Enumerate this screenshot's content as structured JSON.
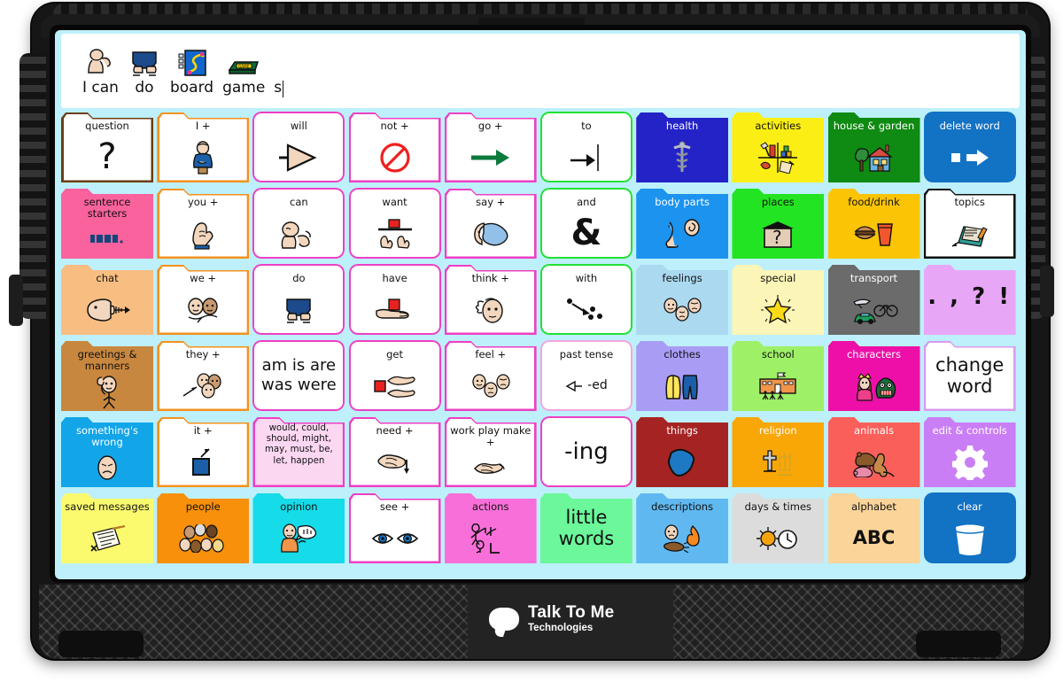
{
  "device": {
    "brand_line1": "Talk To Me",
    "brand_line2": "Technologies"
  },
  "message_bar": {
    "items": [
      {
        "label": "I can",
        "icon": "person-flexing-icon"
      },
      {
        "label": "do",
        "icon": "legs-walking-icon"
      },
      {
        "label": "board",
        "icon": "board-game-icon"
      },
      {
        "label": "game",
        "icon": "game-box-icon"
      },
      {
        "label": "s",
        "icon": "none"
      }
    ],
    "caret": true
  },
  "board": {
    "columns": 10,
    "rows": 6,
    "background": "#bdf0fb",
    "buttons": [
      {
        "label": "question",
        "icon": "question-mark-icon",
        "shape": "folder",
        "fill": "#ffffff",
        "border": "#6b3e14",
        "text": "#111111",
        "icon_text": "?",
        "icon_style": "glyph-qmark"
      },
      {
        "label": "I +",
        "icon": "person-pointing-self-icon",
        "shape": "folder",
        "fill": "#ffffff",
        "border": "#f4911e",
        "text": "#111111"
      },
      {
        "label": "will",
        "icon": "arrow-triangle-icon",
        "shape": "rounded",
        "fill": "#ffffff",
        "border": "#ef3fc4",
        "text": "#111111"
      },
      {
        "label": "not +",
        "icon": "no-entry-icon",
        "shape": "folder",
        "fill": "#ffffff",
        "border": "#ef3fc4",
        "text": "#111111"
      },
      {
        "label": "go +",
        "icon": "green-arrow-right-icon",
        "shape": "folder",
        "fill": "#ffffff",
        "border": "#ef3fc4",
        "text": "#111111"
      },
      {
        "label": "to",
        "icon": "arrow-to-line-icon",
        "shape": "rounded",
        "fill": "#ffffff",
        "border": "#22e032",
        "text": "#111111"
      },
      {
        "label": "health",
        "icon": "caduceus-icon",
        "shape": "folder",
        "fill": "#2323c8",
        "border": "#2323c8",
        "text": "#ffffff"
      },
      {
        "label": "activities",
        "icon": "craft-shelf-icon",
        "shape": "folder",
        "fill": "#fbee14",
        "border": "#fbee14",
        "text": "#111111"
      },
      {
        "label": "house & garden",
        "icon": "house-tree-icon",
        "shape": "folder",
        "fill": "#0f8a12",
        "border": "#0f8a12",
        "text": "#ffffff"
      },
      {
        "label": "delete word",
        "icon": "backspace-icon",
        "shape": "rounded",
        "fill": "#1272c4",
        "border": "#1272c4",
        "text": "#ffffff"
      },
      {
        "label": "sentence\nstarters",
        "icon": "sentence-blocks-icon",
        "shape": "folder",
        "fill": "#f9629c",
        "border": "#f9629c",
        "text": "#111111"
      },
      {
        "label": "you +",
        "icon": "pointing-hand-icon",
        "shape": "folder",
        "fill": "#ffffff",
        "border": "#f4911e",
        "text": "#111111"
      },
      {
        "label": "can",
        "icon": "flexing-arm-icon",
        "shape": "rounded",
        "fill": "#ffffff",
        "border": "#ef3fc4",
        "text": "#111111"
      },
      {
        "label": "want",
        "icon": "hands-reaching-block-icon",
        "shape": "rounded",
        "fill": "#ffffff",
        "border": "#ef3fc4",
        "text": "#111111"
      },
      {
        "label": "say +",
        "icon": "speech-head-icon",
        "shape": "folder",
        "fill": "#ffffff",
        "border": "#ef3fc4",
        "text": "#111111"
      },
      {
        "label": "and",
        "icon": "ampersand-icon",
        "shape": "rounded",
        "fill": "#ffffff",
        "border": "#22e032",
        "text": "#111111",
        "icon_text": "&",
        "icon_style": "glyph-amp"
      },
      {
        "label": "body parts",
        "icon": "ear-leg-icon",
        "shape": "folder",
        "fill": "#1c93ef",
        "border": "#1c93ef",
        "text": "#ffffff"
      },
      {
        "label": "places",
        "icon": "building-question-icon",
        "shape": "folder",
        "fill": "#23e423",
        "border": "#23e423",
        "text": "#111111"
      },
      {
        "label": "food/drink",
        "icon": "burger-drink-icon",
        "shape": "folder",
        "fill": "#fbc405",
        "border": "#fbc405",
        "text": "#111111"
      },
      {
        "label": "topics",
        "icon": "topics-cards-icon",
        "shape": "folder",
        "fill": "#ffffff",
        "border": "#111111",
        "text": "#111111"
      },
      {
        "label": "chat",
        "icon": "talking-head-icon",
        "shape": "folder",
        "fill": "#f7bd81",
        "border": "#f7bd81",
        "text": "#111111"
      },
      {
        "label": "we +",
        "icon": "two-faces-icon",
        "shape": "folder",
        "fill": "#ffffff",
        "border": "#f4911e",
        "text": "#111111"
      },
      {
        "label": "do",
        "icon": "legs-walking-icon",
        "shape": "rounded",
        "fill": "#ffffff",
        "border": "#ef3fc4",
        "text": "#111111"
      },
      {
        "label": "have",
        "icon": "hand-holding-block-icon",
        "shape": "rounded",
        "fill": "#ffffff",
        "border": "#ef3fc4",
        "text": "#111111"
      },
      {
        "label": "think +",
        "icon": "thinking-head-icon",
        "shape": "folder",
        "fill": "#ffffff",
        "border": "#ef3fc4",
        "text": "#111111"
      },
      {
        "label": "with",
        "icon": "arrow-dots-icon",
        "shape": "rounded",
        "fill": "#ffffff",
        "border": "#22e032",
        "text": "#111111"
      },
      {
        "label": "feelings",
        "icon": "three-faces-icon",
        "shape": "folder",
        "fill": "#aad9f0",
        "border": "#aad9f0",
        "text": "#111111"
      },
      {
        "label": "special",
        "icon": "star-burst-icon",
        "shape": "folder",
        "fill": "#fcf5b8",
        "border": "#fcf5b8",
        "text": "#111111"
      },
      {
        "label": "transport",
        "icon": "car-bike-plane-icon",
        "shape": "folder",
        "fill": "#6b6b6b",
        "border": "#6b6b6b",
        "text": "#ffffff"
      },
      {
        "label": "",
        "icon": "punctuation-icon",
        "shape": "folder",
        "fill": "#e8a6f7",
        "border": "#e8a6f7",
        "text": "#111111",
        "icon_text": ".  ,  ?  !",
        "icon_style": "glyph-punct"
      },
      {
        "label": "greetings &\nmanners",
        "icon": "waving-person-icon",
        "shape": "folder",
        "fill": "#cd8game",
        "border": "#c8873f",
        "text": "#111111"
      },
      {
        "label": "they +",
        "icon": "group-faces-arrow-icon",
        "shape": "folder",
        "fill": "#ffffff",
        "border": "#f4911e",
        "text": "#111111"
      },
      {
        "label": "",
        "icon": "none",
        "shape": "rounded",
        "fill": "#ffffff",
        "border": "#ef3fc4",
        "text": "#111111",
        "icon_text": "am is are\nwas were",
        "icon_style": "text-2line"
      },
      {
        "label": "get",
        "icon": "hands-block-icon",
        "shape": "rounded",
        "fill": "#ffffff",
        "border": "#ef3fc4",
        "text": "#111111"
      },
      {
        "label": "feel +",
        "icon": "three-faces-icon",
        "shape": "folder",
        "fill": "#ffffff",
        "border": "#ef3fc4",
        "text": "#111111"
      },
      {
        "label": "past tense",
        "icon": "ed-suffix-icon",
        "shape": "rounded",
        "fill": "#ffffff",
        "border": "#f3a6e0",
        "text": "#111111",
        "icon_text": "-ed",
        "icon_style": "suffix-ed"
      },
      {
        "label": "clothes",
        "icon": "shirt-trousers-icon",
        "shape": "folder",
        "fill": "#a99cf5",
        "border": "#a99cf5",
        "text": "#111111"
      },
      {
        "label": "school",
        "icon": "school-building-icon",
        "shape": "folder",
        "fill": "#9ef067",
        "border": "#9ef067",
        "text": "#111111"
      },
      {
        "label": "characters",
        "icon": "princess-monster-icon",
        "shape": "folder",
        "fill": "#ed0fa8",
        "border": "#ed0fa8",
        "text": "#ffffff"
      },
      {
        "label": "",
        "icon": "none",
        "shape": "folder",
        "fill": "#ffffff",
        "border": "#d89bef",
        "text": "#111111",
        "icon_text": "change\nword",
        "icon_style": "text-2line-big"
      },
      {
        "label": "something's\nwrong",
        "icon": "sad-face-icon",
        "shape": "folder",
        "fill": "#12a5e8",
        "border": "#12a5e8",
        "text": "#ffffff"
      },
      {
        "label": "it +",
        "icon": "blue-square-arrow-icon",
        "shape": "folder",
        "fill": "#ffffff",
        "border": "#f4911e",
        "text": "#111111"
      },
      {
        "label": "would, could,\nshould, might,\nmay, must, be,\nlet, happen",
        "icon": "none",
        "shape": "folder",
        "fill": "#fcd7f2",
        "border": "#ef3fc4",
        "text": "#111111",
        "icon_style": "label-only"
      },
      {
        "label": "need +",
        "icon": "pointing-down-hand-icon",
        "shape": "folder",
        "fill": "#ffffff",
        "border": "#ef3fc4",
        "text": "#111111"
      },
      {
        "label": "work play make\n+",
        "icon": "hands-work-icon",
        "shape": "folder",
        "fill": "#ffffff",
        "border": "#ef3fc4",
        "text": "#111111"
      },
      {
        "label": "",
        "icon": "none",
        "shape": "rounded",
        "fill": "#ffffff",
        "border": "#ef3fc4",
        "text": "#111111",
        "icon_text": "-ing",
        "icon_style": "suffix-ing"
      },
      {
        "label": "things",
        "icon": "blue-blob-icon",
        "shape": "folder",
        "fill": "#a52423",
        "border": "#a52423",
        "text": "#ffffff"
      },
      {
        "label": "religion",
        "icon": "cross-menorah-icon",
        "shape": "folder",
        "fill": "#f9a607",
        "border": "#f9a607",
        "text": "#ffffff"
      },
      {
        "label": "animals",
        "icon": "bear-pig-kangaroo-icon",
        "shape": "folder",
        "fill": "#fa5f5a",
        "border": "#fa5f5a",
        "text": "#ffffff"
      },
      {
        "label": "edit & controls",
        "icon": "gear-icon",
        "shape": "folder",
        "fill": "#ca7ef5",
        "border": "#ca7ef5",
        "text": "#ffffff"
      },
      {
        "label": "saved messages",
        "icon": "note-pencil-icon",
        "shape": "folder",
        "fill": "#fbfa6e",
        "border": "#fbfa6e",
        "text": "#111111"
      },
      {
        "label": "people",
        "icon": "crowd-faces-icon",
        "shape": "folder",
        "fill": "#f8900b",
        "border": "#f8900b",
        "text": "#111111"
      },
      {
        "label": "opinion",
        "icon": "opinion-speech-icon",
        "shape": "folder",
        "fill": "#16dbe8",
        "border": "#16dbe8",
        "text": "#111111"
      },
      {
        "label": "see +",
        "icon": "eyes-icon",
        "shape": "folder",
        "fill": "#ffffff",
        "border": "#ef3fc4",
        "text": "#111111"
      },
      {
        "label": "actions",
        "icon": "stick-figures-icon",
        "shape": "folder",
        "fill": "#f96fd9",
        "border": "#f96fd9",
        "text": "#111111"
      },
      {
        "label": "",
        "icon": "none",
        "shape": "folder",
        "fill": "#6bf79a",
        "border": "#6bf79a",
        "text": "#111111",
        "icon_text": "little\nwords",
        "icon_style": "text-2line-big"
      },
      {
        "label": "descriptions",
        "icon": "hot-cold-icon",
        "shape": "folder",
        "fill": "#60b8f0",
        "border": "#60b8f0",
        "text": "#111111"
      },
      {
        "label": "days & times",
        "icon": "sun-clock-icon",
        "shape": "folder",
        "fill": "#dcdcdc",
        "border": "#dcdcdc",
        "text": "#111111"
      },
      {
        "label": "alphabet",
        "icon": "abc-icon",
        "shape": "folder",
        "fill": "#fbd49a",
        "border": "#fbd49a",
        "text": "#111111",
        "icon_text": "ABC",
        "icon_style": "abc"
      },
      {
        "label": "clear",
        "icon": "trash-icon",
        "shape": "rounded",
        "fill": "#1272c4",
        "border": "#1272c4",
        "text": "#ffffff"
      }
    ]
  }
}
